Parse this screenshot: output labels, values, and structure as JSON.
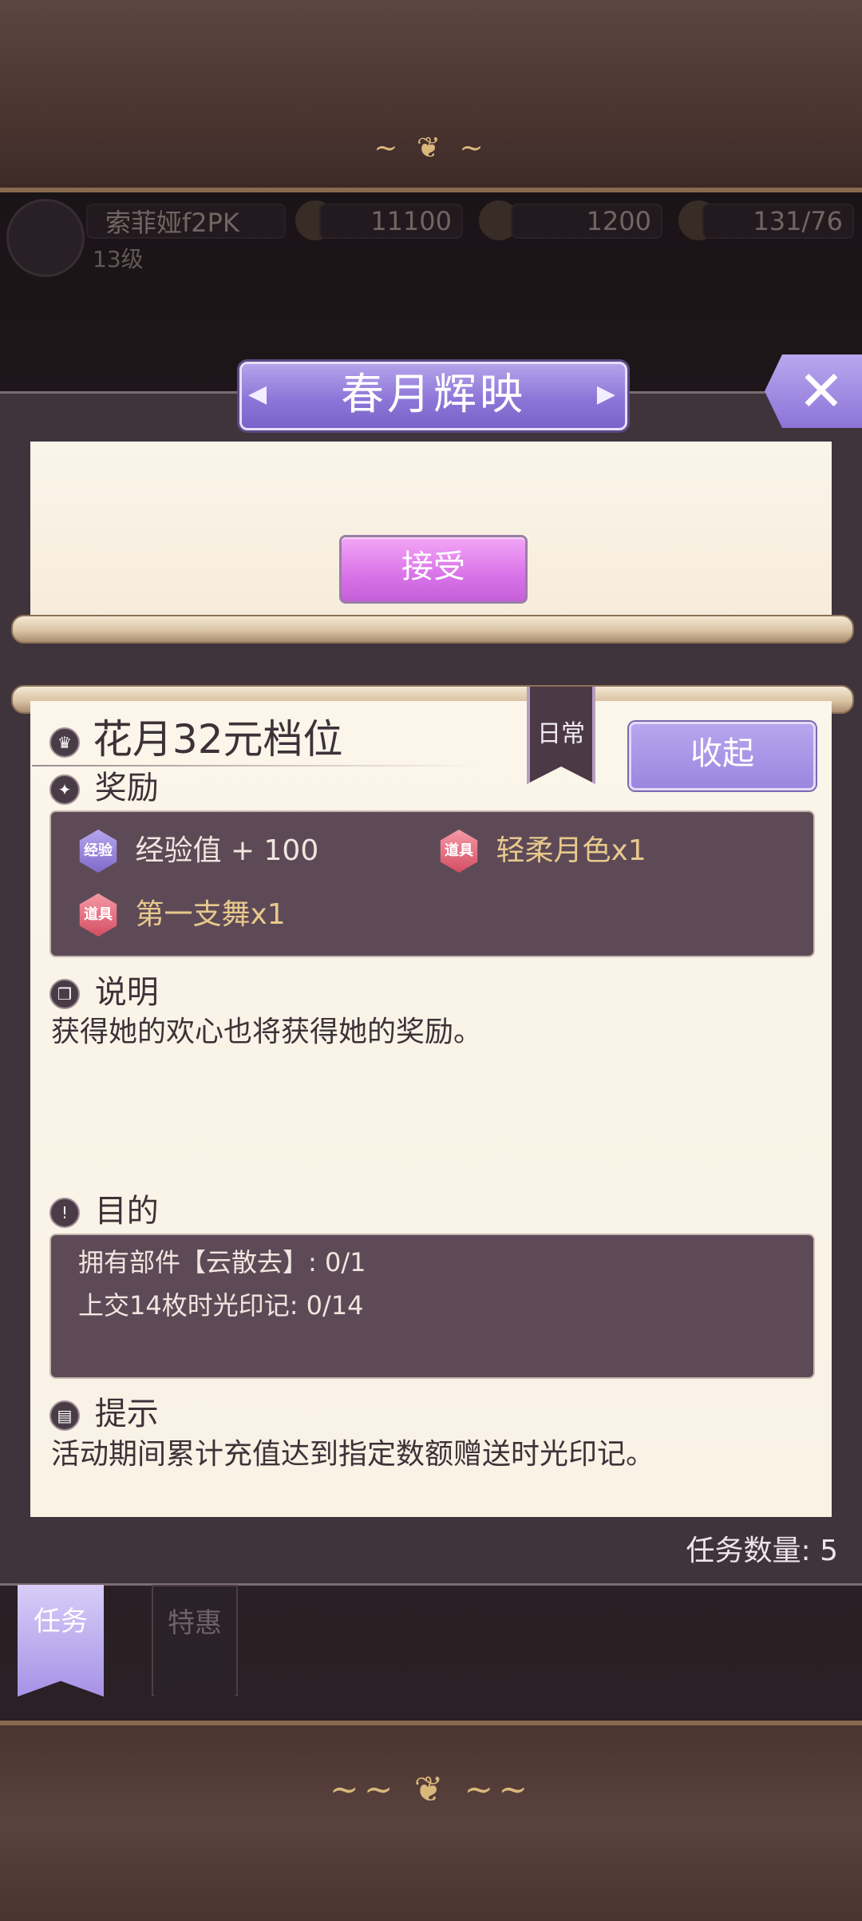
{
  "hud": {
    "player_name": "索菲娅f2PK",
    "level": "13级",
    "gold": "11100",
    "gems": "1200",
    "stamina": "131/76"
  },
  "dialog": {
    "title": "春月辉映",
    "close_icon": "close-x-icon",
    "accept_label": "接受",
    "task": {
      "category_ribbon": "日常",
      "title": "花月32元档位",
      "collapse_label": "收起",
      "reward_heading": "奖励",
      "rewards": [
        {
          "badge": "经验",
          "text": "经验值 + 100"
        },
        {
          "badge": "道具",
          "text": "轻柔月色x1"
        },
        {
          "badge": "道具",
          "text": "第一支舞x1"
        }
      ],
      "description_heading": "说明",
      "description": "获得她的欢心也将获得她的奖励。",
      "goal_heading": "目的",
      "goals": [
        "拥有部件【云散去】: 0/1",
        "上交14枚时光印记: 0/14"
      ],
      "tip_heading": "提示",
      "tip": "活动期间累计充值达到指定数额赠送时光印记。"
    },
    "task_count": "任务数量:  5"
  },
  "tabs": [
    {
      "label": "任务",
      "active": true
    },
    {
      "label": "特惠",
      "active": false
    }
  ],
  "colors": {
    "accent_purple": "#8d76d8",
    "accept_pink": "#d973e8",
    "paper": "#fbf5ea",
    "panel_dark": "#5e4a57",
    "reward_gold": "#e8c98c"
  }
}
